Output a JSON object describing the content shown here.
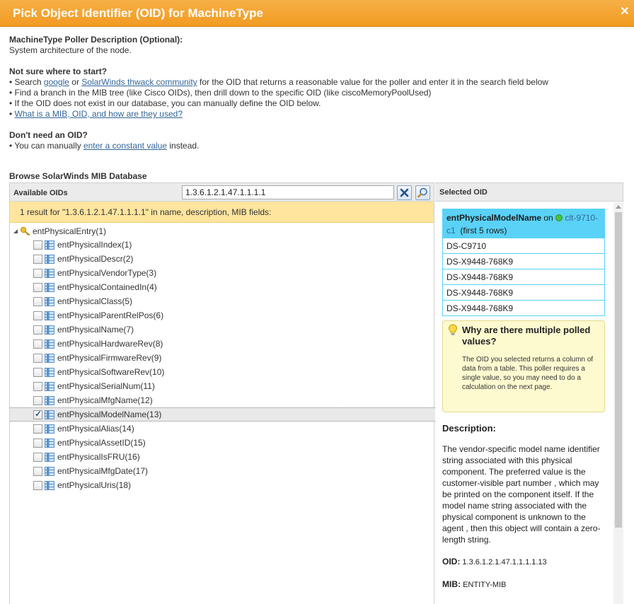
{
  "dialog": {
    "title": "Pick Object Identifier (OID) for MachineType",
    "close_glyph": "✕"
  },
  "intro": {
    "poller_heading": "MachineType Poller Description (Optional):",
    "poller_text": "System architecture of the node.",
    "start_heading": "Not sure where to start?",
    "bullet1_pre": "Search ",
    "bullet1_link1": "google",
    "bullet1_mid": " or ",
    "bullet1_link2": "SolarWinds thwack community",
    "bullet1_post": " for the OID that returns a reasonable value for the poller and enter it in the search field below",
    "bullet2": "Find a branch in the MIB tree (like Cisco OIDs), then drill down to the specific OID (like ciscoMemoryPoolUsed)",
    "bullet3": "If the OID does not exist in our database, you can manually define the OID below.",
    "bullet4_link": "What is a MIB, OID, and how are they used?",
    "dont_heading": "Don't need an OID?",
    "dont_pre": "You can manually ",
    "dont_link": "enter a constant value",
    "dont_post": " instead."
  },
  "browse": {
    "title": "Browse SolarWinds MIB Database",
    "available_label": "Available OIDs",
    "search_value": "1.3.6.1.2.1.47.1.1.1.1",
    "result_text": "1 result for \"1.3.6.1.2.1.47.1.1.1.1\" in name, description, MIB fields:",
    "root_label": "entPhysicalEntry(1)",
    "items": [
      {
        "label": "entPhysicalIndex(1)",
        "checked": false
      },
      {
        "label": "entPhysicalDescr(2)",
        "checked": false
      },
      {
        "label": "entPhysicalVendorType(3)",
        "checked": false
      },
      {
        "label": "entPhysicalContainedIn(4)",
        "checked": false
      },
      {
        "label": "entPhysicalClass(5)",
        "checked": false
      },
      {
        "label": "entPhysicalParentRelPos(6)",
        "checked": false
      },
      {
        "label": "entPhysicalName(7)",
        "checked": false
      },
      {
        "label": "entPhysicalHardwareRev(8)",
        "checked": false
      },
      {
        "label": "entPhysicalFirmwareRev(9)",
        "checked": false
      },
      {
        "label": "entPhysicalSoftwareRev(10)",
        "checked": false
      },
      {
        "label": "entPhysicalSerialNum(11)",
        "checked": false
      },
      {
        "label": "entPhysicalMfgName(12)",
        "checked": false
      },
      {
        "label": "entPhysicalModelName(13)",
        "checked": true
      },
      {
        "label": "entPhysicalAlias(14)",
        "checked": false
      },
      {
        "label": "entPhysicalAssetID(15)",
        "checked": false
      },
      {
        "label": "entPhysicalIsFRU(16)",
        "checked": false
      },
      {
        "label": "entPhysicalMfgDate(17)",
        "checked": false
      },
      {
        "label": "entPhysicalUris(18)",
        "checked": false
      }
    ]
  },
  "selected": {
    "heading": "Selected OID",
    "oid_name": "entPhysicalModelName",
    "on_text": " on ",
    "node_name": "clt-9710-c1",
    "rows_note": "(first 5 rows)",
    "values": [
      "DS-C9710",
      "DS-X9448-768K9",
      "DS-X9448-768K9",
      "DS-X9448-768K9",
      "DS-X9448-768K9"
    ],
    "hint_title": "Why are there multiple polled values?",
    "hint_body": "The OID you selected returns a column of data from a table. This poller requires a single value, so you may need to do a calculation on the next page.",
    "desc_heading": "Description:",
    "desc_text": "The vendor-specific model name identifier string associated with this physical component. The preferred value is the customer-visible part number , which may be printed on the component itself. If the model name string associated with the physical component is unknown to the agent , then this object will contain a zero-length string.",
    "oid_label": "OID:",
    "oid_value": "1.3.6.1.2.1.47.1.1.1.1.13",
    "mib_label": "MIB:",
    "mib_value": "ENTITY-MIB"
  },
  "colors": {
    "title_orange": "#f19b22",
    "result_yellow": "#ffe59e",
    "selected_cyan": "#5ad2f7",
    "link_blue": "#336699"
  }
}
